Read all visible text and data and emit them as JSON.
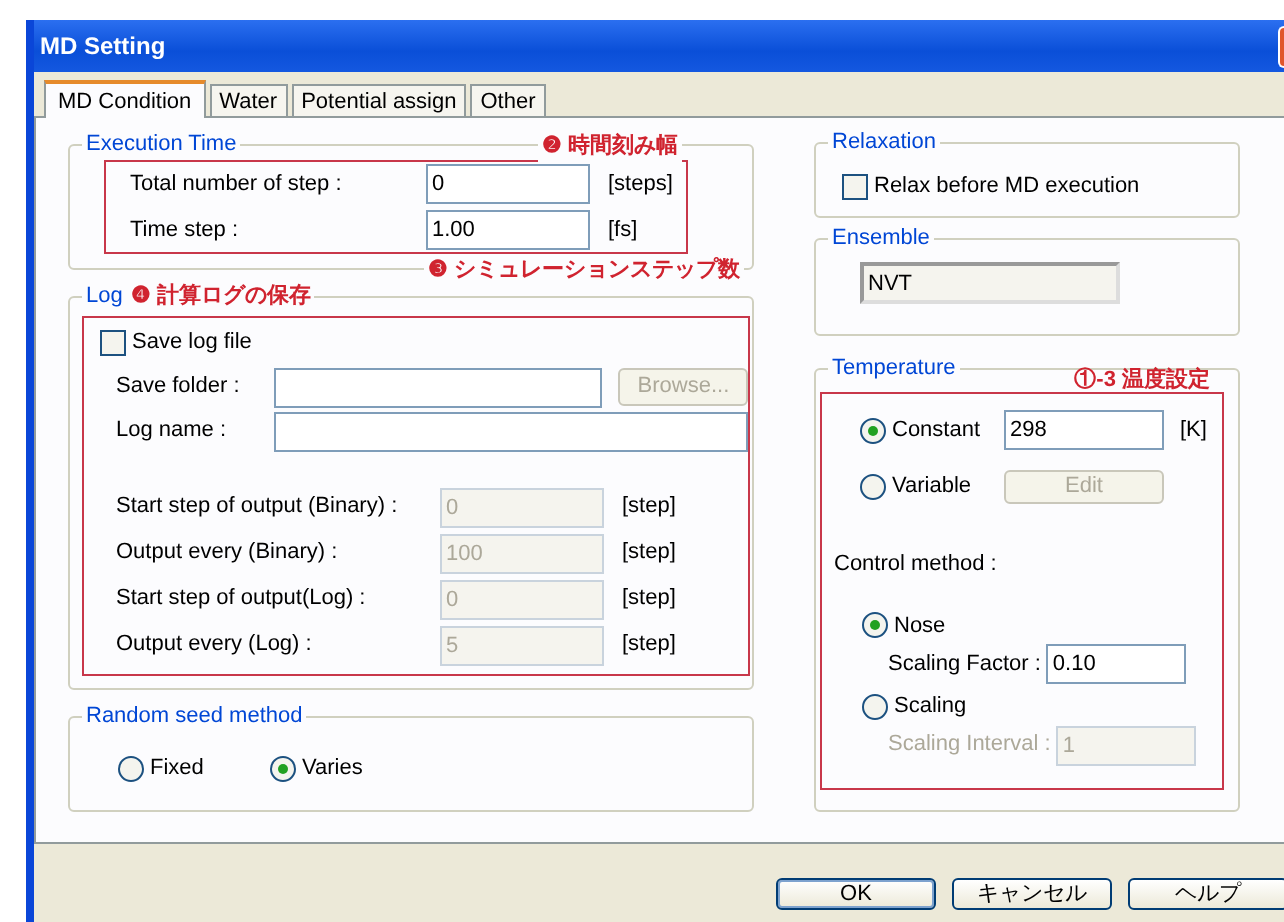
{
  "window": {
    "title": "MD Setting"
  },
  "tabs": [
    {
      "label": "MD Condition",
      "selected": true
    },
    {
      "label": "Water",
      "selected": false
    },
    {
      "label": "Potential assign",
      "selected": false
    },
    {
      "label": "Other",
      "selected": false
    }
  ],
  "execution_time": {
    "title": "Execution Time",
    "annotation": "❷ 時間刻み幅",
    "rows": [
      {
        "label": "Total number of step :",
        "value": "0",
        "unit": "[steps]"
      },
      {
        "label": "Time step :",
        "value": "1.00",
        "unit": "[fs]"
      }
    ],
    "note": "❸ シミュレーションステップ数"
  },
  "log": {
    "title": "Log",
    "annotation": "❹ 計算ログの保存",
    "save_log": {
      "label": "Save log file",
      "checked": false
    },
    "save_folder": {
      "label": "Save folder :"
    },
    "browse_button": {
      "label": "Browse...",
      "disabled": true
    },
    "log_name": {
      "label": "Log name :"
    },
    "outputs": [
      {
        "label": "Start step of output (Binary) :",
        "value": "0",
        "unit": "[step]",
        "disabled": true
      },
      {
        "label": "Output every (Binary) :",
        "value": "100",
        "unit": "[step]",
        "disabled": true
      },
      {
        "label": "Start step of output(Log) :",
        "value": "0",
        "unit": "[step]",
        "disabled": true
      },
      {
        "label": "Output every (Log) :",
        "value": "5",
        "unit": "[step]",
        "disabled": true
      }
    ]
  },
  "random_seed": {
    "title": "Random seed method",
    "options": [
      {
        "label": "Fixed",
        "selected": false
      },
      {
        "label": "Varies",
        "selected": true
      }
    ]
  },
  "relaxation": {
    "title": "Relaxation",
    "checkbox": {
      "label": "Relax before MD execution",
      "checked": false
    }
  },
  "ensemble": {
    "title": "Ensemble",
    "value": "NVT"
  },
  "temperature": {
    "title": "Temperature",
    "annotation": "①-3 温度設定",
    "modes": [
      {
        "kind": "field",
        "label": "Constant",
        "selected": true,
        "value": "298",
        "unit": "[K]"
      },
      {
        "kind": "button",
        "label": "Variable",
        "selected": false,
        "button": "Edit",
        "disabled": true
      }
    ],
    "control_label": "Control method :",
    "methods": [
      {
        "label": "Nose",
        "selected": true,
        "field_label": "Scaling Factor :",
        "value": "0.10",
        "disabled": false
      },
      {
        "label": "Scaling",
        "selected": false,
        "field_label": "Scaling Interval :",
        "value": "1",
        "disabled": true
      }
    ]
  },
  "buttons": [
    {
      "label": "OK",
      "default": true
    },
    {
      "label": "キャンセル",
      "default": false
    },
    {
      "label": "ヘルプ",
      "default": false
    }
  ]
}
